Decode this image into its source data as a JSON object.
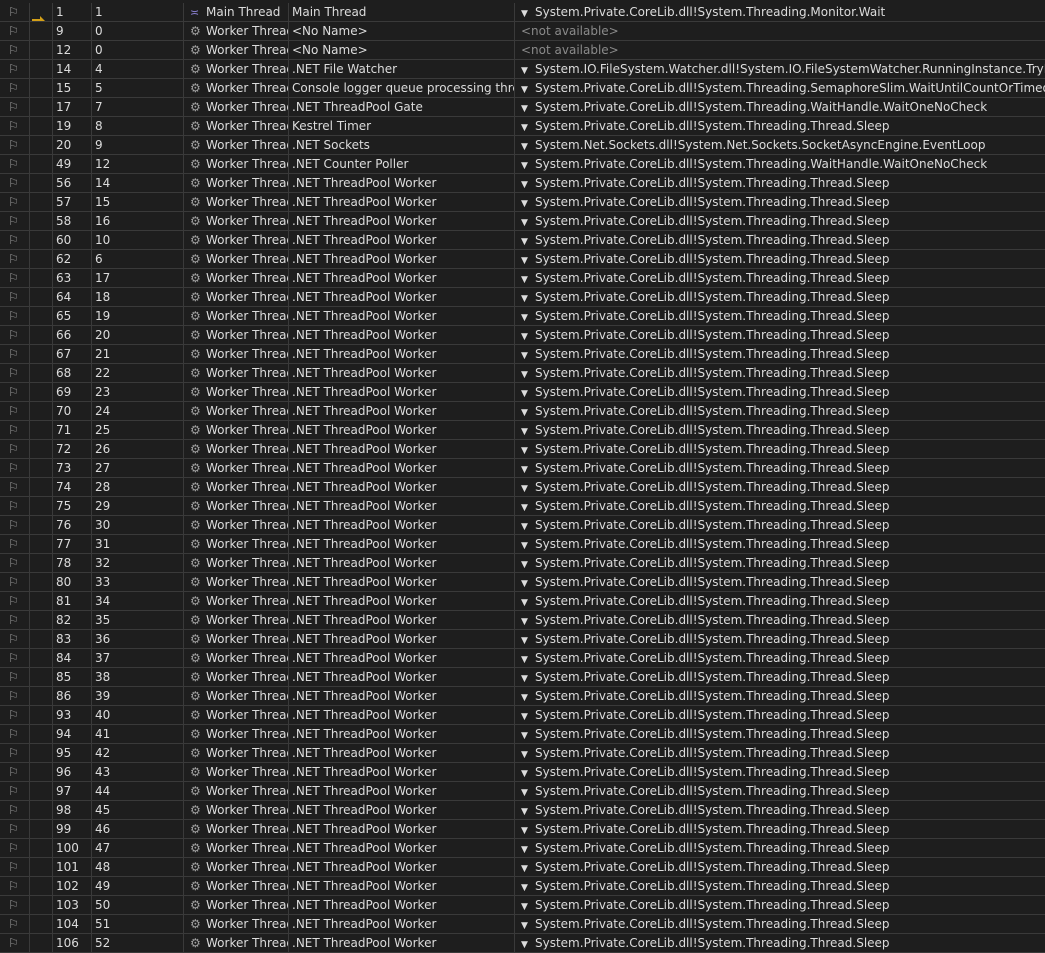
{
  "colors": {
    "background": "#1e1e1e",
    "current_thread_arrow": "#d4a017",
    "not_available": "#8a8a8a"
  },
  "icons": {
    "flag": "flag-icon",
    "current": "current-thread-arrow-icon",
    "main": "main-thread-icon",
    "worker": "worker-thread-gear-icon",
    "expand": "chevron-down-icon"
  },
  "rows": [
    [
      "1",
      "1",
      "Main Thread",
      "Main Thread",
      "System.Private.CoreLib.dll!System.Threading.Monitor.Wait"
    ],
    [
      "9",
      "0",
      "Worker Thread",
      "<No Name>",
      "<not available>"
    ],
    [
      "12",
      "0",
      "Worker Thread",
      "<No Name>",
      "<not available>"
    ],
    [
      "14",
      "4",
      "Worker Thread",
      ".NET File Watcher",
      "System.IO.FileSystem.Watcher.dll!System.IO.FileSystemWatcher.RunningInstance.TryReadEvent"
    ],
    [
      "15",
      "5",
      "Worker Thread",
      "Console logger queue processing thread",
      "System.Private.CoreLib.dll!System.Threading.SemaphoreSlim.WaitUntilCountOrTimeout"
    ],
    [
      "17",
      "7",
      "Worker Thread",
      ".NET ThreadPool Gate",
      "System.Private.CoreLib.dll!System.Threading.WaitHandle.WaitOneNoCheck"
    ],
    [
      "19",
      "8",
      "Worker Thread",
      "Kestrel Timer",
      "System.Private.CoreLib.dll!System.Threading.Thread.Sleep"
    ],
    [
      "20",
      "9",
      "Worker Thread",
      ".NET Sockets",
      "System.Net.Sockets.dll!System.Net.Sockets.SocketAsyncEngine.EventLoop"
    ],
    [
      "49",
      "12",
      "Worker Thread",
      ".NET Counter Poller",
      "System.Private.CoreLib.dll!System.Threading.WaitHandle.WaitOneNoCheck"
    ],
    [
      "56",
      "14",
      "Worker Thread",
      ".NET ThreadPool Worker",
      "System.Private.CoreLib.dll!System.Threading.Thread.Sleep"
    ],
    [
      "57",
      "15",
      "Worker Thread",
      ".NET ThreadPool Worker",
      "System.Private.CoreLib.dll!System.Threading.Thread.Sleep"
    ],
    [
      "58",
      "16",
      "Worker Thread",
      ".NET ThreadPool Worker",
      "System.Private.CoreLib.dll!System.Threading.Thread.Sleep"
    ],
    [
      "60",
      "10",
      "Worker Thread",
      ".NET ThreadPool Worker",
      "System.Private.CoreLib.dll!System.Threading.Thread.Sleep"
    ],
    [
      "62",
      "6",
      "Worker Thread",
      ".NET ThreadPool Worker",
      "System.Private.CoreLib.dll!System.Threading.Thread.Sleep"
    ],
    [
      "63",
      "17",
      "Worker Thread",
      ".NET ThreadPool Worker",
      "System.Private.CoreLib.dll!System.Threading.Thread.Sleep"
    ],
    [
      "64",
      "18",
      "Worker Thread",
      ".NET ThreadPool Worker",
      "System.Private.CoreLib.dll!System.Threading.Thread.Sleep"
    ],
    [
      "65",
      "19",
      "Worker Thread",
      ".NET ThreadPool Worker",
      "System.Private.CoreLib.dll!System.Threading.Thread.Sleep"
    ],
    [
      "66",
      "20",
      "Worker Thread",
      ".NET ThreadPool Worker",
      "System.Private.CoreLib.dll!System.Threading.Thread.Sleep"
    ],
    [
      "67",
      "21",
      "Worker Thread",
      ".NET ThreadPool Worker",
      "System.Private.CoreLib.dll!System.Threading.Thread.Sleep"
    ],
    [
      "68",
      "22",
      "Worker Thread",
      ".NET ThreadPool Worker",
      "System.Private.CoreLib.dll!System.Threading.Thread.Sleep"
    ],
    [
      "69",
      "23",
      "Worker Thread",
      ".NET ThreadPool Worker",
      "System.Private.CoreLib.dll!System.Threading.Thread.Sleep"
    ],
    [
      "70",
      "24",
      "Worker Thread",
      ".NET ThreadPool Worker",
      "System.Private.CoreLib.dll!System.Threading.Thread.Sleep"
    ],
    [
      "71",
      "25",
      "Worker Thread",
      ".NET ThreadPool Worker",
      "System.Private.CoreLib.dll!System.Threading.Thread.Sleep"
    ],
    [
      "72",
      "26",
      "Worker Thread",
      ".NET ThreadPool Worker",
      "System.Private.CoreLib.dll!System.Threading.Thread.Sleep"
    ],
    [
      "73",
      "27",
      "Worker Thread",
      ".NET ThreadPool Worker",
      "System.Private.CoreLib.dll!System.Threading.Thread.Sleep"
    ],
    [
      "74",
      "28",
      "Worker Thread",
      ".NET ThreadPool Worker",
      "System.Private.CoreLib.dll!System.Threading.Thread.Sleep"
    ],
    [
      "75",
      "29",
      "Worker Thread",
      ".NET ThreadPool Worker",
      "System.Private.CoreLib.dll!System.Threading.Thread.Sleep"
    ],
    [
      "76",
      "30",
      "Worker Thread",
      ".NET ThreadPool Worker",
      "System.Private.CoreLib.dll!System.Threading.Thread.Sleep"
    ],
    [
      "77",
      "31",
      "Worker Thread",
      ".NET ThreadPool Worker",
      "System.Private.CoreLib.dll!System.Threading.Thread.Sleep"
    ],
    [
      "78",
      "32",
      "Worker Thread",
      ".NET ThreadPool Worker",
      "System.Private.CoreLib.dll!System.Threading.Thread.Sleep"
    ],
    [
      "80",
      "33",
      "Worker Thread",
      ".NET ThreadPool Worker",
      "System.Private.CoreLib.dll!System.Threading.Thread.Sleep"
    ],
    [
      "81",
      "34",
      "Worker Thread",
      ".NET ThreadPool Worker",
      "System.Private.CoreLib.dll!System.Threading.Thread.Sleep"
    ],
    [
      "82",
      "35",
      "Worker Thread",
      ".NET ThreadPool Worker",
      "System.Private.CoreLib.dll!System.Threading.Thread.Sleep"
    ],
    [
      "83",
      "36",
      "Worker Thread",
      ".NET ThreadPool Worker",
      "System.Private.CoreLib.dll!System.Threading.Thread.Sleep"
    ],
    [
      "84",
      "37",
      "Worker Thread",
      ".NET ThreadPool Worker",
      "System.Private.CoreLib.dll!System.Threading.Thread.Sleep"
    ],
    [
      "85",
      "38",
      "Worker Thread",
      ".NET ThreadPool Worker",
      "System.Private.CoreLib.dll!System.Threading.Thread.Sleep"
    ],
    [
      "86",
      "39",
      "Worker Thread",
      ".NET ThreadPool Worker",
      "System.Private.CoreLib.dll!System.Threading.Thread.Sleep"
    ],
    [
      "93",
      "40",
      "Worker Thread",
      ".NET ThreadPool Worker",
      "System.Private.CoreLib.dll!System.Threading.Thread.Sleep"
    ],
    [
      "94",
      "41",
      "Worker Thread",
      ".NET ThreadPool Worker",
      "System.Private.CoreLib.dll!System.Threading.Thread.Sleep"
    ],
    [
      "95",
      "42",
      "Worker Thread",
      ".NET ThreadPool Worker",
      "System.Private.CoreLib.dll!System.Threading.Thread.Sleep"
    ],
    [
      "96",
      "43",
      "Worker Thread",
      ".NET ThreadPool Worker",
      "System.Private.CoreLib.dll!System.Threading.Thread.Sleep"
    ],
    [
      "97",
      "44",
      "Worker Thread",
      ".NET ThreadPool Worker",
      "System.Private.CoreLib.dll!System.Threading.Thread.Sleep"
    ],
    [
      "98",
      "45",
      "Worker Thread",
      ".NET ThreadPool Worker",
      "System.Private.CoreLib.dll!System.Threading.Thread.Sleep"
    ],
    [
      "99",
      "46",
      "Worker Thread",
      ".NET ThreadPool Worker",
      "System.Private.CoreLib.dll!System.Threading.Thread.Sleep"
    ],
    [
      "100",
      "47",
      "Worker Thread",
      ".NET ThreadPool Worker",
      "System.Private.CoreLib.dll!System.Threading.Thread.Sleep"
    ],
    [
      "101",
      "48",
      "Worker Thread",
      ".NET ThreadPool Worker",
      "System.Private.CoreLib.dll!System.Threading.Thread.Sleep"
    ],
    [
      "102",
      "49",
      "Worker Thread",
      ".NET ThreadPool Worker",
      "System.Private.CoreLib.dll!System.Threading.Thread.Sleep"
    ],
    [
      "103",
      "50",
      "Worker Thread",
      ".NET ThreadPool Worker",
      "System.Private.CoreLib.dll!System.Threading.Thread.Sleep"
    ],
    [
      "104",
      "51",
      "Worker Thread",
      ".NET ThreadPool Worker",
      "System.Private.CoreLib.dll!System.Threading.Thread.Sleep"
    ],
    [
      "106",
      "52",
      "Worker Thread",
      ".NET ThreadPool Worker",
      "System.Private.CoreLib.dll!System.Threading.Thread.Sleep"
    ]
  ]
}
